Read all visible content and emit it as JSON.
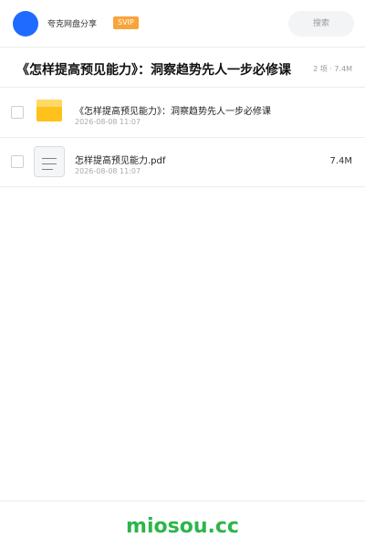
{
  "header": {
    "brand": "夸克网盘分享",
    "badge": "SVIP",
    "search_placeholder": "搜索"
  },
  "share": {
    "title": "《怎样提高预见能力》：洞察趋势先人一步必修课",
    "meta": "2 项 · 7.4M"
  },
  "files": [
    {
      "name": "《怎样提高预见能力》：洞察趋势先人一步必修课",
      "date": "2026-08-08 11:07",
      "size": "",
      "icon": "folder-icon"
    },
    {
      "name": "怎样提高预见能力.pdf",
      "date": "2026-08-08 11:07",
      "size": "7.4M",
      "icon": "document-icon"
    }
  ],
  "footer": {
    "brand": "miosou.cc"
  },
  "colors": {
    "accent": "#1f6bff",
    "badge": "#f7a43b",
    "folder": "#ffc21a",
    "footer_brand": "#2db54a"
  }
}
